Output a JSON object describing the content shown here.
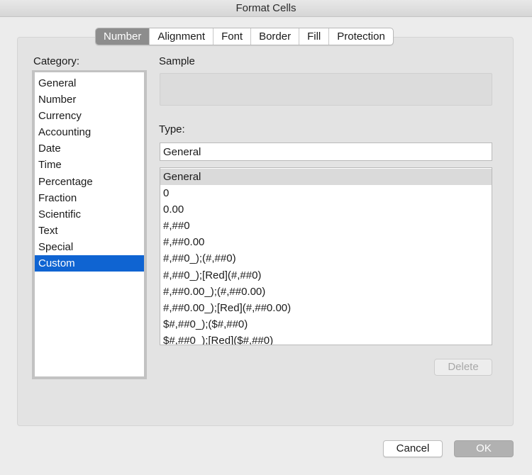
{
  "window": {
    "title": "Format Cells"
  },
  "tabs": [
    {
      "label": "Number",
      "active": true
    },
    {
      "label": "Alignment",
      "active": false
    },
    {
      "label": "Font",
      "active": false
    },
    {
      "label": "Border",
      "active": false
    },
    {
      "label": "Fill",
      "active": false
    },
    {
      "label": "Protection",
      "active": false
    }
  ],
  "category": {
    "label": "Category:",
    "items": [
      "General",
      "Number",
      "Currency",
      "Accounting",
      "Date",
      "Time",
      "Percentage",
      "Fraction",
      "Scientific",
      "Text",
      "Special",
      "Custom"
    ],
    "selected": "Custom"
  },
  "sample": {
    "label": "Sample",
    "value": ""
  },
  "type": {
    "label": "Type:",
    "value": "General",
    "formats": [
      "General",
      "0",
      "0.00",
      "#,##0",
      "#,##0.00",
      "#,##0_);(#,##0)",
      "#,##0_);[Red](#,##0)",
      "#,##0.00_);(#,##0.00)",
      "#,##0.00_);[Red](#,##0.00)",
      "$#,##0_);($#,##0)",
      "$#,##0_);[Red]($#,##0)"
    ],
    "selected_format": "General"
  },
  "buttons": {
    "delete": "Delete",
    "cancel": "Cancel",
    "ok": "OK"
  },
  "colors": {
    "selection_blue": "#0f64d2",
    "active_tab": "#8d8d8d",
    "panel_bg": "#e3e3e3",
    "window_bg": "#ececec"
  }
}
